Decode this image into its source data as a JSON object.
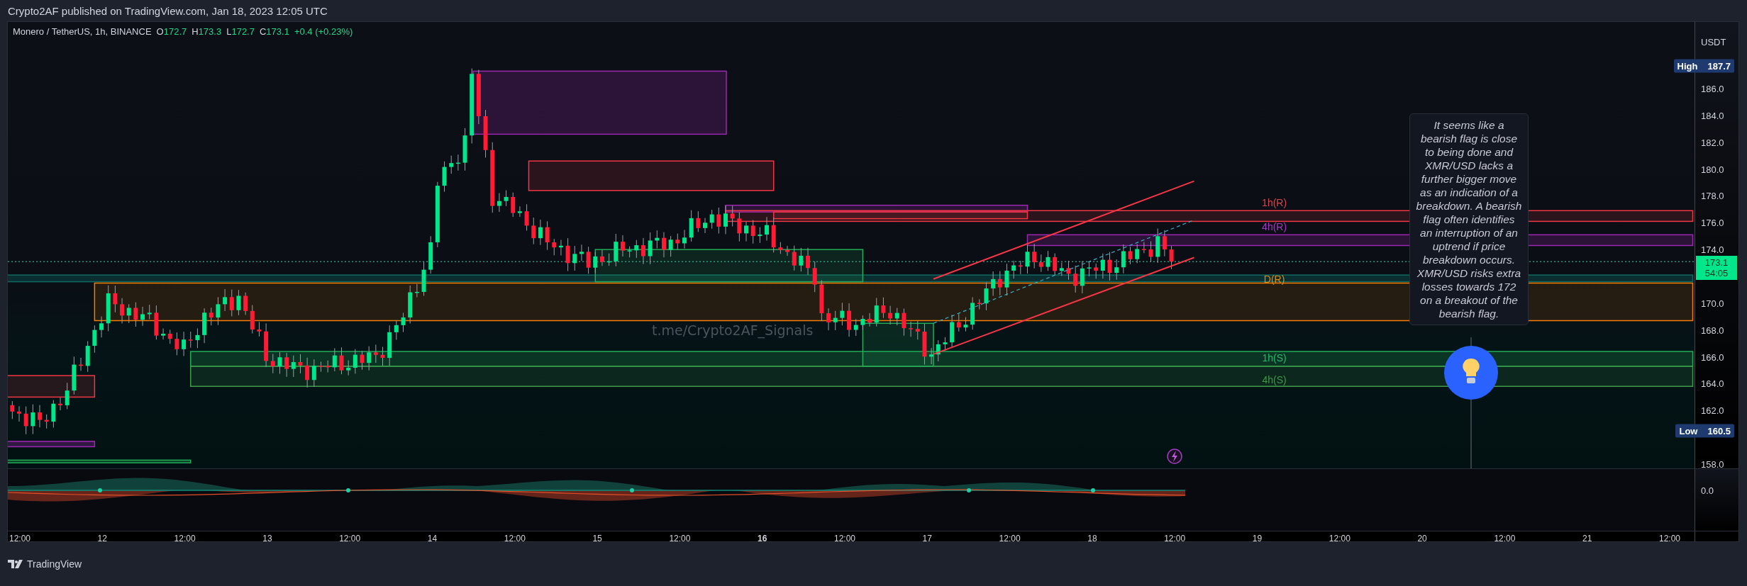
{
  "header": {
    "publisher_line": "Crypto2AF published on TradingView.com, Jan 18, 2023 12:05 UTC"
  },
  "legend": {
    "symbol": "Monero / TetherUS, 1h, BINANCE",
    "ohlc": [
      {
        "label": "O",
        "value": "172.7"
      },
      {
        "label": "H",
        "value": "173.3"
      },
      {
        "label": "L",
        "value": "172.7"
      },
      {
        "label": "C",
        "value": "173.1"
      }
    ],
    "change": "+0.4 (+0.23%)"
  },
  "chart": {
    "zone_labels": [
      {
        "text": "1h(R)",
        "color": "#d9474d"
      },
      {
        "text": "4h(R)",
        "color": "#a33bc0"
      },
      {
        "text": "D(R)",
        "color": "#e08a0e"
      },
      {
        "text": "1h(S)",
        "color": "#1fbf6a"
      },
      {
        "text": "4h(S)",
        "color": "#3f9a4a"
      }
    ],
    "overlay_text": "t.me/Crypto2AF_Signals",
    "note": "It seems like a bearish flag is close to being done and XMR/USD lacks a further bigger move as an indication of a breakdown. A bearish flag often identifies an interruption of an uptrend if price breakdown occurs. XMR/USD risks extra losses towards 172 on a breakout of the bearish flag."
  },
  "price_axis": {
    "unit": "USDT",
    "ticks": [
      "186.0",
      "184.0",
      "182.0",
      "180.0",
      "178.0",
      "176.0",
      "174.0",
      "170.0",
      "168.0",
      "166.0",
      "164.0",
      "162.0",
      "158.0"
    ],
    "high": {
      "label": "High",
      "value": "187.7"
    },
    "low": {
      "label": "Low",
      "value": "160.5"
    },
    "last": {
      "price": "173.1",
      "countdown": "54:05"
    }
  },
  "indicator_axis": {
    "ticks": [
      "0.0"
    ]
  },
  "time_axis": {
    "labels": [
      {
        "text": "12:00",
        "bold": false
      },
      {
        "text": "12",
        "bold": false
      },
      {
        "text": "12:00",
        "bold": false
      },
      {
        "text": "13",
        "bold": false
      },
      {
        "text": "12:00",
        "bold": false
      },
      {
        "text": "14",
        "bold": false
      },
      {
        "text": "12:00",
        "bold": false
      },
      {
        "text": "15",
        "bold": false
      },
      {
        "text": "12:00",
        "bold": false
      },
      {
        "text": "16",
        "bold": true
      },
      {
        "text": "12:00",
        "bold": false
      },
      {
        "text": "17",
        "bold": false
      },
      {
        "text": "12:00",
        "bold": false
      },
      {
        "text": "18",
        "bold": false
      },
      {
        "text": "12:00",
        "bold": false
      },
      {
        "text": "19",
        "bold": false
      },
      {
        "text": "12:00",
        "bold": false
      },
      {
        "text": "20",
        "bold": false
      },
      {
        "text": "12:00",
        "bold": false
      },
      {
        "text": "21",
        "bold": false
      },
      {
        "text": "12:00",
        "bold": false
      }
    ]
  },
  "footer": {
    "brand": "TradingView"
  }
}
